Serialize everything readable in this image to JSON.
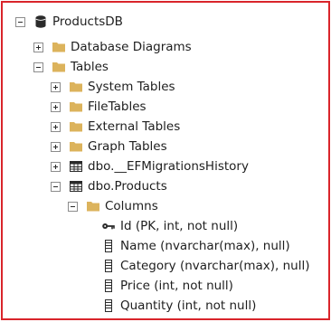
{
  "tree": {
    "root": {
      "label": "ProductsDB",
      "icon": "database-icon",
      "expanded": true
    },
    "nodes": [
      {
        "label": "Database Diagrams",
        "icon": "folder-icon",
        "toggle": "collapsed"
      },
      {
        "label": "Tables",
        "icon": "folder-icon",
        "toggle": "expanded"
      },
      {
        "label": "System Tables",
        "icon": "folder-icon",
        "toggle": "collapsed"
      },
      {
        "label": "FileTables",
        "icon": "folder-icon",
        "toggle": "collapsed"
      },
      {
        "label": "External Tables",
        "icon": "folder-icon",
        "toggle": "collapsed"
      },
      {
        "label": "Graph Tables",
        "icon": "folder-icon",
        "toggle": "collapsed"
      },
      {
        "label": "dbo.__EFMigrationsHistory",
        "icon": "table-icon",
        "toggle": "collapsed"
      },
      {
        "label": "dbo.Products",
        "icon": "table-icon",
        "toggle": "expanded"
      },
      {
        "label": "Columns",
        "icon": "folder-icon",
        "toggle": "expanded"
      },
      {
        "label": "Id (PK, int, not null)",
        "icon": "primary-key-icon"
      },
      {
        "label": "Name (nvarchar(max), null)",
        "icon": "column-icon"
      },
      {
        "label": "Category (nvarchar(max), null)",
        "icon": "column-icon"
      },
      {
        "label": "Price (int, not null)",
        "icon": "column-icon"
      },
      {
        "label": "Quantity (int, not null)",
        "icon": "column-icon"
      }
    ]
  },
  "colors": {
    "frame_border": "#d9252b",
    "folder": "#dcb35c",
    "database": "#2b2b2b",
    "text": "#1e1e1e"
  }
}
